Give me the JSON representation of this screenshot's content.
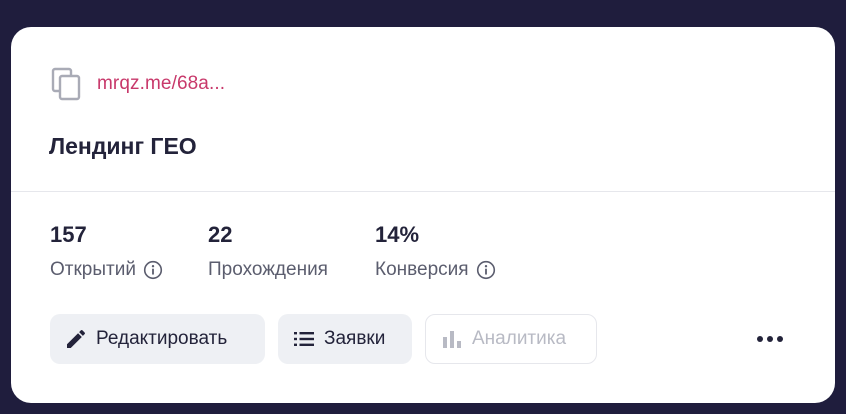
{
  "card": {
    "link": "mrqz.me/68a...",
    "title": "Лендинг ГЕО",
    "colors": {
      "link": "#c8396b",
      "text": "#23233a",
      "muted": "#5b5d6e",
      "disabled": "#b8bac4",
      "button_bg": "#eef0f4",
      "page_bg": "#1f1d3d"
    }
  },
  "stats": [
    {
      "value": "157",
      "label": "Открытий",
      "has_info": true
    },
    {
      "value": "22",
      "label": "Прохождения",
      "has_info": false
    },
    {
      "value": "14%",
      "label": "Конверсия",
      "has_info": true
    }
  ],
  "actions": {
    "edit": {
      "label": "Редактировать",
      "icon": "pencil-icon"
    },
    "leads": {
      "label": "Заявки",
      "icon": "list-icon"
    },
    "analytics": {
      "label": "Аналитика",
      "icon": "bar-chart-icon",
      "disabled": true
    },
    "more": {
      "icon": "more-dots-icon"
    }
  }
}
